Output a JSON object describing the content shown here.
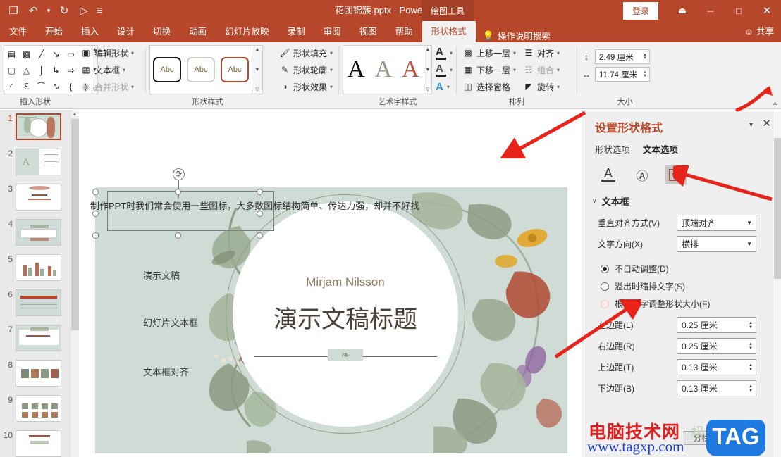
{
  "titlebar": {
    "quick_access": [
      {
        "name": "save-icon",
        "glyph": "❐"
      },
      {
        "name": "undo-icon",
        "glyph": "↶"
      },
      {
        "name": "undo-dropdown-icon",
        "glyph": "▾"
      },
      {
        "name": "redo-icon",
        "glyph": "↻"
      },
      {
        "name": "start-slideshow-icon",
        "glyph": "▷"
      },
      {
        "name": "customize-qat-icon",
        "glyph": "☰"
      }
    ],
    "document_title": "花团锦簇.pptx  -  PowerPoint",
    "context_tab": "绘图工具",
    "signin": "登录",
    "ribbon_display_icon": "⏏",
    "minimize": "─",
    "maximize": "□",
    "close": "✕"
  },
  "tabs": [
    {
      "label": "文件",
      "active": false
    },
    {
      "label": "开始",
      "active": false
    },
    {
      "label": "插入",
      "active": false
    },
    {
      "label": "设计",
      "active": false
    },
    {
      "label": "切换",
      "active": false
    },
    {
      "label": "动画",
      "active": false
    },
    {
      "label": "幻灯片放映",
      "active": false
    },
    {
      "label": "录制",
      "active": false
    },
    {
      "label": "审阅",
      "active": false
    },
    {
      "label": "视图",
      "active": false
    },
    {
      "label": "帮助",
      "active": false
    },
    {
      "label": "形状格式",
      "active": true
    }
  ],
  "tell_me": "操作说明搜索",
  "share": "共享",
  "ribbon": {
    "groups": {
      "insert_shapes": {
        "label": "插入形状",
        "commands": [
          {
            "label": "编辑形状",
            "has_caret": true,
            "disabled": false,
            "icon": "edit-shape-icon"
          },
          {
            "label": "文本框",
            "has_caret": true,
            "disabled": false,
            "icon": "text-box-icon"
          },
          {
            "label": "合并形状",
            "has_caret": true,
            "disabled": true,
            "icon": "merge-shapes-icon"
          }
        ],
        "shape_glyphs": [
          "▤",
          "▥",
          "╲",
          "↘",
          "▭",
          "○",
          "▢",
          "△",
          "⌐",
          "↱",
          "⇨",
          "⇩",
          "◔",
          "⌇",
          "⌒",
          "∿",
          "{",
          "}"
        ]
      },
      "shape_styles": {
        "label": "形状样式",
        "thumb_text": "Abc",
        "commands": [
          {
            "label": "形状填充",
            "has_caret": true,
            "icon": "shape-fill-icon"
          },
          {
            "label": "形状轮廓",
            "has_caret": true,
            "icon": "shape-outline-icon"
          },
          {
            "label": "形状效果",
            "has_caret": true,
            "icon": "shape-effects-icon"
          }
        ]
      },
      "wordart_styles": {
        "label": "艺术字样式",
        "sample": "A",
        "commands": [
          {
            "icon": "text-fill-icon",
            "has_caret": true
          },
          {
            "icon": "text-outline-icon",
            "has_caret": true
          },
          {
            "icon": "text-effects-icon",
            "has_caret": true
          }
        ]
      },
      "arrange": {
        "label": "排列",
        "commands": [
          {
            "label": "上移一层",
            "has_caret": true,
            "disabled": false,
            "icon": "bring-forward-icon"
          },
          {
            "label": "下移一层",
            "has_caret": true,
            "disabled": false,
            "icon": "send-backward-icon"
          },
          {
            "label": "选择窗格",
            "has_caret": false,
            "disabled": false,
            "icon": "selection-pane-icon"
          },
          {
            "label": "对齐",
            "has_caret": true,
            "disabled": false,
            "icon": "align-icon"
          },
          {
            "label": "组合",
            "has_caret": true,
            "disabled": true,
            "icon": "group-icon"
          },
          {
            "label": "旋转",
            "has_caret": true,
            "disabled": false,
            "icon": "rotate-icon"
          }
        ]
      },
      "size": {
        "label": "大小",
        "height_value": "2.49 厘米",
        "width_value": "11.74 厘米",
        "height_icon": "shape-height-icon",
        "width_icon": "shape-width-icon"
      }
    }
  },
  "thumbnails": {
    "slides": [
      {
        "number": "1",
        "selected": true
      },
      {
        "number": "2",
        "selected": false
      },
      {
        "number": "3",
        "selected": false
      },
      {
        "number": "4",
        "selected": false
      },
      {
        "number": "5",
        "selected": false
      },
      {
        "number": "6",
        "selected": false
      },
      {
        "number": "7",
        "selected": false
      },
      {
        "number": "8",
        "selected": false
      },
      {
        "number": "9",
        "selected": false
      },
      {
        "number": "10",
        "selected": false
      }
    ]
  },
  "slide": {
    "selected_textbox_text": "制作PPT时我们常会使用一些图标，大多数图标结构简单、传达力强，却并不好找",
    "side_labels": [
      "演示文稿",
      "幻灯片文本框",
      "文本框对齐"
    ],
    "subtitle": "Mirjam Nilsson",
    "title": "演示文稿标题",
    "background_color": "#cfdcd6"
  },
  "pane": {
    "title": "设置形状格式",
    "dropdown_icon": "▾",
    "close_icon": "✕",
    "tabs": [
      {
        "label": "形状选项",
        "active": false
      },
      {
        "label": "文本选项",
        "active": true
      }
    ],
    "icon_tabs": [
      {
        "name": "text-fill-outline-icon",
        "glyph": "A",
        "active": false
      },
      {
        "name": "text-effects-icon",
        "glyph": "Ⓐ",
        "active": false
      },
      {
        "name": "textbox-layout-icon",
        "glyph": "A≡",
        "active": true
      }
    ],
    "section": {
      "label": "文本框",
      "chevron": "∨"
    },
    "fields": [
      {
        "label": "垂直对齐方式(V)",
        "type": "combo",
        "value": "顶端对齐"
      },
      {
        "label": "文字方向(X)",
        "type": "combo",
        "value": "横排"
      }
    ],
    "radios": [
      {
        "label": "不自动调整(D)",
        "selected": true,
        "highlight": false
      },
      {
        "label": "溢出时缩排文字(S)",
        "selected": false,
        "highlight": false
      },
      {
        "label": "根据文字调整形状大小(F)",
        "selected": false,
        "highlight": true
      }
    ],
    "margins": [
      {
        "label": "左边距(L)",
        "value": "0.25 厘米"
      },
      {
        "label": "右边距(R)",
        "value": "0.25 厘米"
      },
      {
        "label": "上边距(T)",
        "value": "0.13 厘米"
      },
      {
        "label": "下边距(B)",
        "value": "0.13 厘米"
      }
    ],
    "columns_button": "分栏(C)..."
  },
  "watermark": {
    "red_text": "电脑技术网",
    "url": "www.tagxp.com",
    "badge": "TAG",
    "faint_text": "极光下载"
  },
  "colors": {
    "accent": "#b7472a",
    "ribbon_bg": "#f1f1f1",
    "pane_bg": "#efefef",
    "slide_bg": "#cfdcd6",
    "annotation_arrow": "#e8241a"
  }
}
